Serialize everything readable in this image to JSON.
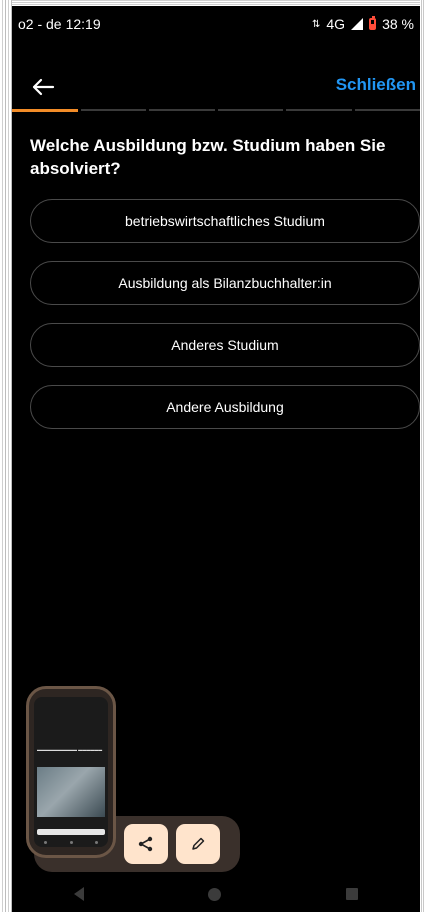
{
  "status_bar": {
    "carrier": "o2 - de",
    "time": "12:19",
    "network": "4G",
    "battery": "38 %"
  },
  "header": {
    "close_label": "Schließen"
  },
  "progress": {
    "total_steps": 6,
    "current_step": 1
  },
  "question": {
    "text": "Welche Ausbildung bzw. Studium haben Sie absolviert?"
  },
  "options": [
    "betriebswirtschaftliches Studium",
    "Ausbildung als Bilanzbuchhalter:in",
    "Anderes Studium",
    "Andere Ausbildung"
  ],
  "colors": {
    "accent": "#2196f3",
    "progress_active": "#f28c28",
    "overlay_button": "#ffe4cc"
  },
  "icons": {
    "back": "arrow-left-icon",
    "share": "share-icon",
    "edit": "pencil-icon"
  }
}
